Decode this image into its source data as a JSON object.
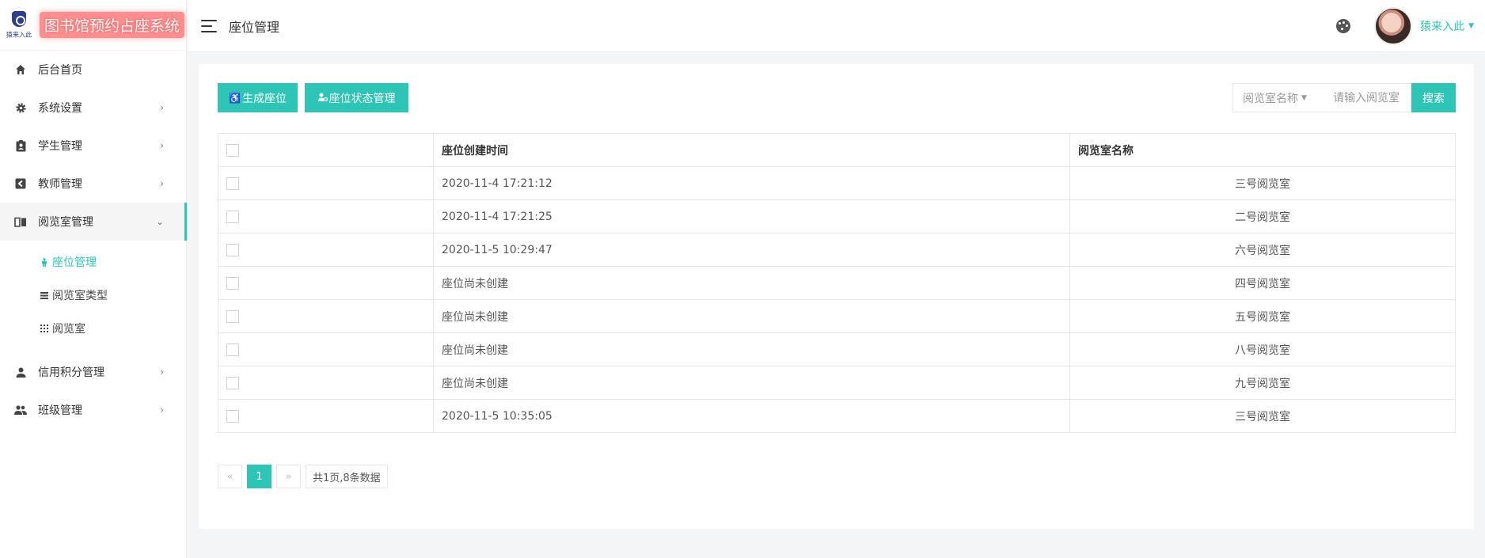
{
  "brand": {
    "logo_text": "猿来入此",
    "title": "图书馆预约占座系统"
  },
  "sidebar": {
    "items": [
      {
        "label": "后台首页",
        "icon": "home-icon"
      },
      {
        "label": "系统设置",
        "icon": "gear-icon"
      },
      {
        "label": "学生管理",
        "icon": "student-badge-icon"
      },
      {
        "label": "教师管理",
        "icon": "teacher-icon"
      },
      {
        "label": "阅览室管理",
        "icon": "book-icon"
      },
      {
        "label": "信用积分管理",
        "icon": "person-icon"
      },
      {
        "label": "班级管理",
        "icon": "group-icon"
      }
    ],
    "submenu": [
      {
        "label": "座位管理",
        "icon": "person-standing-icon"
      },
      {
        "label": "阅览室类型",
        "icon": "list-icon"
      },
      {
        "label": "阅览室",
        "icon": "grid-icon"
      }
    ]
  },
  "header": {
    "page_title": "座位管理",
    "username": "猿来入此"
  },
  "toolbar": {
    "generate_label": "生成座位",
    "status_label": "座位状态管理",
    "select_label": "阅览室名称",
    "search_placeholder": "请输入阅览室",
    "search_label": "搜索"
  },
  "table": {
    "headers": [
      "座位创建时间",
      "阅览室名称"
    ],
    "rows": [
      {
        "time": "2020-11-4 17:21:12",
        "room": "三号阅览室"
      },
      {
        "time": "2020-11-4 17:21:25",
        "room": "二号阅览室"
      },
      {
        "time": "2020-11-5 10:29:47",
        "room": "六号阅览室"
      },
      {
        "time": "座位尚未创建",
        "room": "四号阅览室"
      },
      {
        "time": "座位尚未创建",
        "room": "五号阅览室"
      },
      {
        "time": "座位尚未创建",
        "room": "八号阅览室"
      },
      {
        "time": "座位尚未创建",
        "room": "九号阅览室"
      },
      {
        "time": "2020-11-5 10:35:05",
        "room": "三号阅览室"
      }
    ]
  },
  "pagination": {
    "prev": "«",
    "current": "1",
    "next": "»",
    "info": "共1页,8条数据"
  },
  "colors": {
    "accent": "#2ec4b6",
    "brand_title_bg": "#ff8f8f"
  }
}
